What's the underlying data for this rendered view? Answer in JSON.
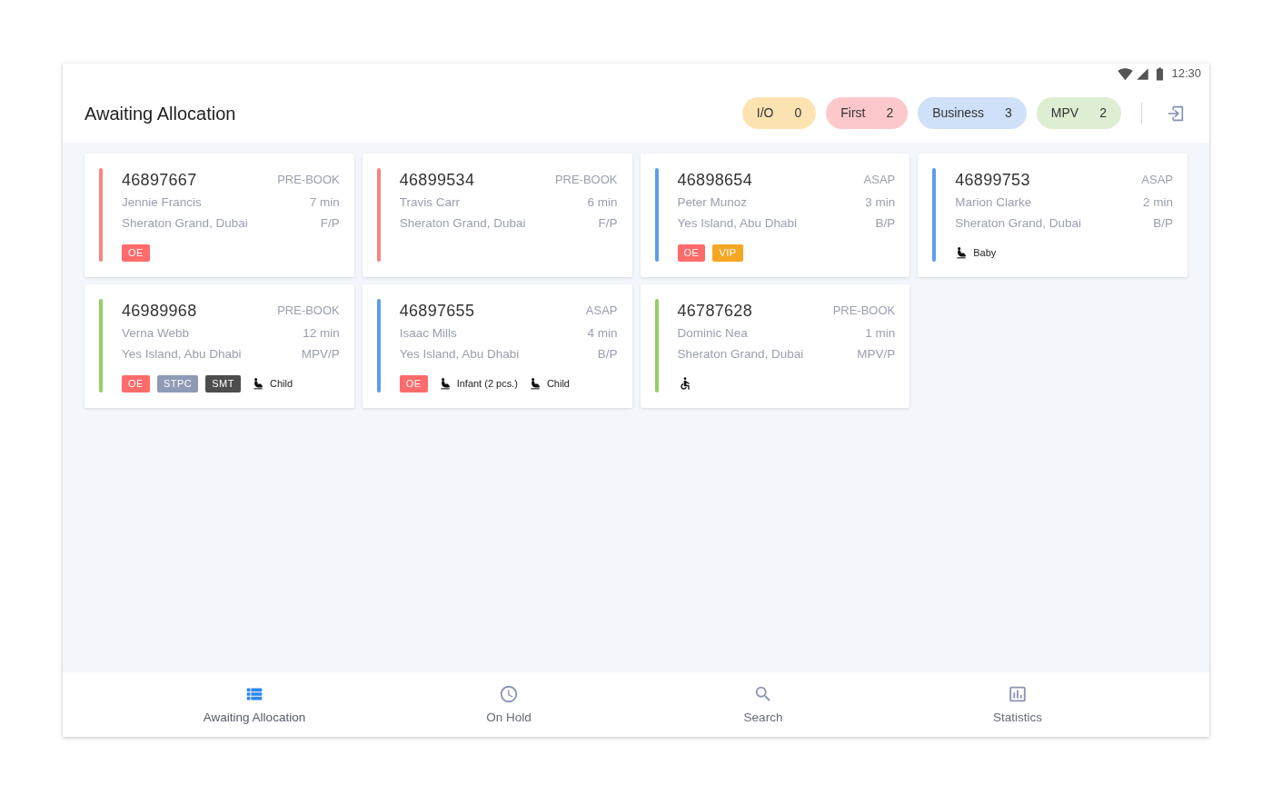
{
  "status_bar": {
    "time": "12:30"
  },
  "header": {
    "title": "Awaiting Allocation",
    "counters": [
      {
        "label": "I/O",
        "count": "0",
        "color": "#fde3b1"
      },
      {
        "label": "First",
        "count": "2",
        "color": "#fdc8cc"
      },
      {
        "label": "Business",
        "count": "3",
        "color": "#cfe1f8"
      },
      {
        "label": "MPV",
        "count": "2",
        "color": "#ddeed2"
      }
    ]
  },
  "bookings": [
    {
      "number": "46897667",
      "type": "PRE-BOOK",
      "name": "Jennie Francis",
      "wait": "7 min",
      "hotel": "Sheraton Grand, Dubai",
      "class": "F/P",
      "color": "#f98383",
      "tags": [
        {
          "label": "OE",
          "color": "#ff6b6b"
        }
      ]
    },
    {
      "number": "46899534",
      "type": "PRE-BOOK",
      "name": "Travis Carr",
      "wait": "6 min",
      "hotel": "Sheraton Grand, Dubai",
      "class": "F/P",
      "color": "#f98383"
    },
    {
      "number": "46898654",
      "type": "ASAP",
      "name": "Peter Munoz",
      "wait": "3 min",
      "hotel": "Yes Island, Abu Dhabi",
      "class": "B/P",
      "color": "#5c9ded",
      "tags": [
        {
          "label": "OE",
          "color": "#ff6b6b"
        },
        {
          "label": "VIP",
          "color": "#f5a623"
        }
      ]
    },
    {
      "number": "46899753",
      "type": "ASAP",
      "name": "Marion Clarke",
      "wait": "2 min",
      "hotel": "Sheraton Grand, Dubai",
      "class": "B/P",
      "color": "#5c9ded",
      "extras": [
        {
          "kind": "seat",
          "label": "Baby"
        }
      ]
    },
    {
      "number": "46989968",
      "type": "PRE-BOOK",
      "name": "Verna Webb",
      "wait": "12 min",
      "hotel": "Yes Island, Abu Dhabi",
      "class": "MPV/P",
      "color": "#96cf63",
      "tags": [
        {
          "label": "OE",
          "color": "#ff6b6b"
        },
        {
          "label": "STPC",
          "color": "#8f9ab6"
        },
        {
          "label": "SMT",
          "color": "#4d4d4d"
        }
      ],
      "extras": [
        {
          "kind": "seat",
          "label": "Child"
        }
      ]
    },
    {
      "number": "46897655",
      "type": "ASAP",
      "name": "Isaac Mills",
      "wait": "4 min",
      "hotel": "Yes Island, Abu Dhabi",
      "class": "B/P",
      "color": "#5c9ded",
      "tags": [
        {
          "label": "OE",
          "color": "#ff6b6b"
        }
      ],
      "extras": [
        {
          "kind": "seat",
          "label": "Infant (2 pcs.)"
        },
        {
          "kind": "seat",
          "label": "Child"
        }
      ]
    },
    {
      "number": "46787628",
      "type": "PRE-BOOK",
      "name": "Dominic Nea",
      "wait": "1 min",
      "hotel": "Sheraton Grand, Dubai",
      "class": "MPV/P",
      "color": "#96cf63",
      "extras": [
        {
          "kind": "wheelchair"
        }
      ]
    }
  ],
  "nav": [
    {
      "kind": "list",
      "label": "Awaiting Allocation",
      "selected": true
    },
    {
      "kind": "clock",
      "label": "On Hold",
      "selected": false
    },
    {
      "kind": "search",
      "label": "Search",
      "selected": false
    },
    {
      "kind": "chart",
      "label": "Statistics",
      "selected": false
    }
  ]
}
